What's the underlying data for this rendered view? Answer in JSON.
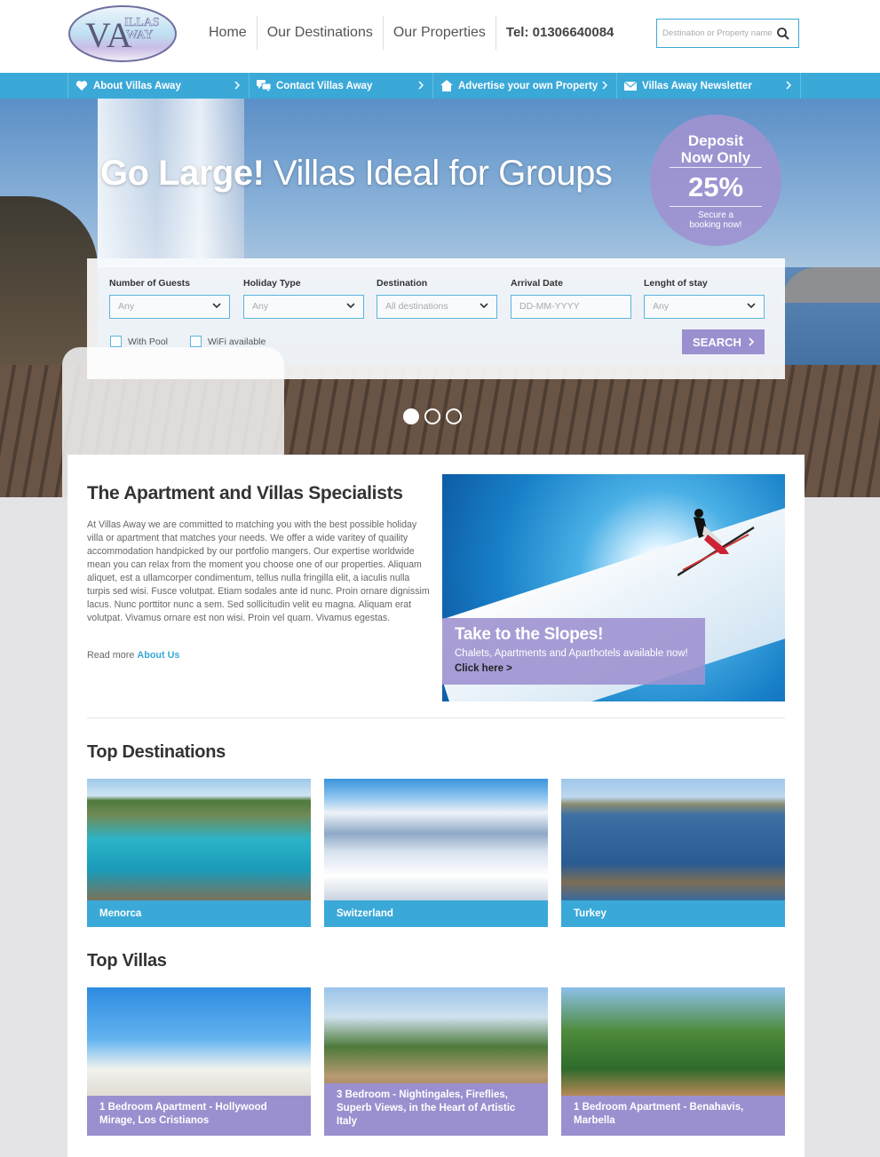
{
  "header": {
    "logo_text": "Villas Away",
    "nav": [
      "Home",
      "Our Destinations",
      "Our Properties"
    ],
    "tel": "Tel: 01306640084",
    "search_placeholder": "Destination or Property name"
  },
  "subnav": [
    {
      "label": "About Villas Away",
      "icon": "heart-icon"
    },
    {
      "label": "Contact Villas Away",
      "icon": "chat-icon"
    },
    {
      "label": "Advertise your own Property",
      "icon": "house-icon"
    },
    {
      "label": "Villas Away Newsletter",
      "icon": "envelope-icon"
    }
  ],
  "hero": {
    "title_bold": "Go Large!",
    "title_rest": " Villas Ideal for Groups",
    "deposit": {
      "line1": "Deposit",
      "line2": "Now Only",
      "percent": "25%",
      "line3": "Secure a",
      "line4": "booking now!"
    },
    "slide_count": 3,
    "active_slide": 1
  },
  "search": {
    "guests": {
      "label": "Number of Guests",
      "value": "Any"
    },
    "holiday_type": {
      "label": "Holiday Type",
      "value": "Any"
    },
    "destination": {
      "label": "Destination",
      "value": "All destinations"
    },
    "arrival": {
      "label": "Arrival Date",
      "placeholder": "DD-MM-YYYY"
    },
    "length": {
      "label": "Lenght of stay",
      "value": "Any"
    },
    "with_pool": "With Pool",
    "wifi": "WiFi available",
    "button": "SEARCH"
  },
  "intro": {
    "title": "The Apartment and Villas Specialists",
    "text": "At Villas Away we are committed to matching you with the best possible holiday villa or apartment that matches your needs. We offer a wide varitey of quaility accommodation handpicked by our portfolio mangers. Our expertise worldwide mean you can relax from the moment you choose one of our properties. Aliquam aliquet, est a ullamcorper condimentum, tellus nulla fringilla elit, a iaculis nulla turpis sed wisi. Fusce volutpat. Etiam sodales ante id nunc. Proin ornare dignissim lacus. Nunc porttitor nunc a sem. Sed sollicitudin velit eu magna. Aliquam erat volutpat. Vivamus ornare est non wisi. Proin vel quam. Vivamus egestas.",
    "readmore_prefix": "Read more ",
    "readmore_link": "About Us"
  },
  "promo": {
    "title": "Take to the Slopes!",
    "text": "Chalets, Apartments and Aparthotels available now! ",
    "link": "Click here >"
  },
  "top_destinations": {
    "title": "Top Destinations",
    "items": [
      "Menorca",
      "Switzerland",
      "Turkey"
    ]
  },
  "top_villas": {
    "title": "Top Villas",
    "items": [
      "1 Bedroom Apartment - Hollywood Mirage, Los Cristianos",
      "3 Bedroom - Nightingales, Fireflies, Superb Views, in the Heart of Artistic Italy",
      "1 Bedroom Apartment - Benahavis, Marbella"
    ]
  },
  "colors": {
    "accent_blue": "#3aa9d8",
    "accent_purple": "#9a90cf"
  }
}
